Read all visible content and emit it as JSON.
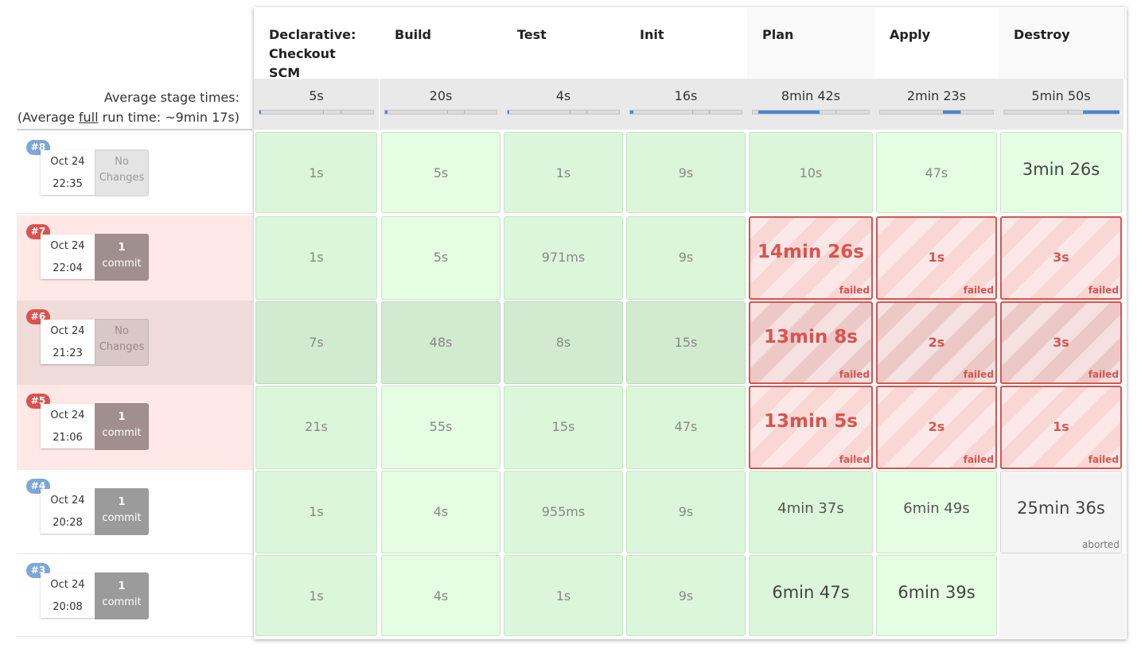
{
  "stages": [
    {
      "name": "Declarative: Checkout SCM",
      "avg": "5s"
    },
    {
      "name": "Build",
      "avg": "20s"
    },
    {
      "name": "Test",
      "avg": "4s"
    },
    {
      "name": "Init",
      "avg": "16s"
    },
    {
      "name": "Plan",
      "avg": "8min 42s"
    },
    {
      "name": "Apply",
      "avg": "2min 23s"
    },
    {
      "name": "Destroy",
      "avg": "5min 50s"
    }
  ],
  "avg_label": {
    "line1": "Average stage times:",
    "line2_prefix": "(Average ",
    "line2_underlined": "full",
    "line2_suffix": " run time: ~9min 17s)"
  },
  "avg_bar_fraction": [
    0.01,
    0.02,
    0.01,
    0.03,
    0.52,
    0.15,
    0.32
  ],
  "runs": [
    {
      "id": "#8",
      "date": "Oct 24",
      "time": "22:35",
      "changes_line1": "No",
      "changes_line2": "Changes",
      "cells": [
        {
          "dur": "1s",
          "status": "success"
        },
        {
          "dur": "5s",
          "status": "success"
        },
        {
          "dur": "1s",
          "status": "success"
        },
        {
          "dur": "9s",
          "status": "success"
        },
        {
          "dur": "10s",
          "status": "success"
        },
        {
          "dur": "47s",
          "status": "success"
        },
        {
          "dur": "3min 26s",
          "status": "success"
        }
      ]
    },
    {
      "id": "#7",
      "date": "Oct 24",
      "time": "22:04",
      "changes_line1": "1",
      "changes_line2": "commit",
      "cells": [
        {
          "dur": "1s",
          "status": "success"
        },
        {
          "dur": "5s",
          "status": "success"
        },
        {
          "dur": "971ms",
          "status": "success"
        },
        {
          "dur": "9s",
          "status": "success"
        },
        {
          "dur": "14min 26s",
          "status": "failed",
          "label": "failed"
        },
        {
          "dur": "1s",
          "status": "failed",
          "label": "failed"
        },
        {
          "dur": "3s",
          "status": "failed",
          "label": "failed"
        }
      ]
    },
    {
      "id": "#6",
      "date": "Oct 24",
      "time": "21:23",
      "changes_line1": "No",
      "changes_line2": "Changes",
      "cells": [
        {
          "dur": "7s",
          "status": "success"
        },
        {
          "dur": "48s",
          "status": "success"
        },
        {
          "dur": "8s",
          "status": "success"
        },
        {
          "dur": "15s",
          "status": "success"
        },
        {
          "dur": "13min 8s",
          "status": "failed",
          "label": "failed"
        },
        {
          "dur": "2s",
          "status": "failed",
          "label": "failed"
        },
        {
          "dur": "3s",
          "status": "failed",
          "label": "failed"
        }
      ]
    },
    {
      "id": "#5",
      "date": "Oct 24",
      "time": "21:06",
      "changes_line1": "1",
      "changes_line2": "commit",
      "cells": [
        {
          "dur": "21s",
          "status": "success"
        },
        {
          "dur": "55s",
          "status": "success"
        },
        {
          "dur": "15s",
          "status": "success"
        },
        {
          "dur": "47s",
          "status": "success"
        },
        {
          "dur": "13min 5s",
          "status": "failed",
          "label": "failed"
        },
        {
          "dur": "2s",
          "status": "failed",
          "label": "failed"
        },
        {
          "dur": "1s",
          "status": "failed",
          "label": "failed"
        }
      ]
    },
    {
      "id": "#4",
      "date": "Oct 24",
      "time": "20:28",
      "changes_line1": "1",
      "changes_line2": "commit",
      "cells": [
        {
          "dur": "1s",
          "status": "success"
        },
        {
          "dur": "4s",
          "status": "success"
        },
        {
          "dur": "955ms",
          "status": "success"
        },
        {
          "dur": "9s",
          "status": "success"
        },
        {
          "dur": "4min 37s",
          "status": "success"
        },
        {
          "dur": "6min 49s",
          "status": "success"
        },
        {
          "dur": "25min 36s",
          "status": "aborted",
          "label": "aborted"
        }
      ]
    },
    {
      "id": "#3",
      "date": "Oct 24",
      "time": "20:08",
      "changes_line1": "1",
      "changes_line2": "commit",
      "cells": [
        {
          "dur": "1s",
          "status": "success"
        },
        {
          "dur": "4s",
          "status": "success"
        },
        {
          "dur": "1s",
          "status": "success"
        },
        {
          "dur": "9s",
          "status": "success"
        },
        {
          "dur": "6min 47s",
          "status": "success"
        },
        {
          "dur": "6min 39s",
          "status": "success"
        },
        {
          "dur": "",
          "status": "not-run"
        }
      ]
    }
  ],
  "colors": {
    "success": "#dbf6da",
    "failed": "#d9534f",
    "aborted": "#f4f4f4",
    "badge_ok": "#7da7d8",
    "badge_failed": "#d9534f",
    "progress": "#4a86d6"
  }
}
